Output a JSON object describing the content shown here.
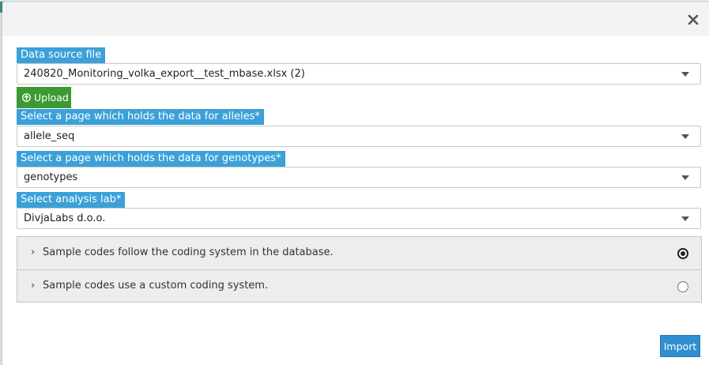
{
  "dialog": {
    "fields": {
      "data_source": {
        "label": "Data source file",
        "value": "240820_Monitoring_volka_export__test_mbase.xlsx (2)"
      },
      "upload": {
        "label": "Upload"
      },
      "alleles_page": {
        "label": "Select a page which holds the data for alleles*",
        "value": "allele_seq"
      },
      "genotypes_page": {
        "label": "Select a page which holds the data for genotypes*",
        "value": "genotypes"
      },
      "analysis_lab": {
        "label": "Select analysis lab*",
        "value": "DivjaLabs d.o.o."
      }
    },
    "coding_options": [
      {
        "label": "Sample codes follow the coding system in the database.",
        "selected": true
      },
      {
        "label": "Sample codes use a custom coding system.",
        "selected": false
      }
    ],
    "import_label": "Import",
    "colors": {
      "label_bg": "#3ba1d8",
      "upload_bg": "#3d9a33",
      "import_bg": "#2f8fd0"
    },
    "icons": [
      "close-icon",
      "upload-arrow-icon",
      "caret-down-icon",
      "chevron-right-icon"
    ]
  }
}
